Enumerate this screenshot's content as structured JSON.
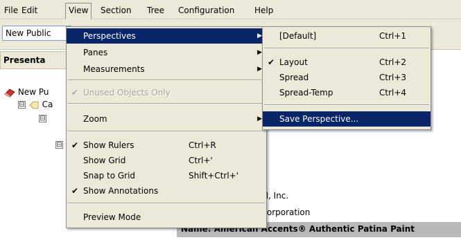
{
  "menubar": {
    "items": [
      "File",
      "Edit",
      "View",
      "Section",
      "Tree",
      "Configuration",
      "Help"
    ]
  },
  "toolbar": {
    "publication_value": "New Public"
  },
  "panel": {
    "header": "Presenta",
    "tree": [
      "New Pu",
      "Ca"
    ],
    "expander_symbol": "⊟",
    "behind_rows": [
      "ational, Inc.",
      "eum Corporation",
      "Name: American Accents® Authentic Patina Paint"
    ]
  },
  "view_menu": {
    "items": [
      {
        "label": "Perspectives",
        "submenu": true,
        "highlighted": true
      },
      {
        "label": "Panes",
        "submenu": true
      },
      {
        "label": "Measurements",
        "submenu": true
      },
      {
        "label": "Unused Objects Only",
        "checked": true,
        "disabled": true
      },
      {
        "label": "Zoom",
        "submenu": true
      },
      {
        "label": "Show Rulers",
        "shortcut": "Ctrl+R",
        "checked": true
      },
      {
        "label": "Show Grid",
        "shortcut": "Ctrl+'"
      },
      {
        "label": "Snap to Grid",
        "shortcut": "Shift+Ctrl+'"
      },
      {
        "label": "Show Annotations",
        "checked": true
      },
      {
        "label": "Preview Mode"
      }
    ]
  },
  "perspectives_menu": {
    "items": [
      {
        "label": "[Default]",
        "shortcut": "Ctrl+1"
      },
      {
        "label": "Layout",
        "shortcut": "Ctrl+2",
        "checked": true
      },
      {
        "label": "Spread",
        "shortcut": "Ctrl+3"
      },
      {
        "label": "Spread-Temp",
        "shortcut": "Ctrl+4"
      },
      {
        "label": "Save Perspective...",
        "highlighted": true
      }
    ]
  },
  "icons": {
    "check": "✔",
    "submenu_arrow": "▶"
  },
  "colors": {
    "menu_bg": "#ece9d8",
    "highlight": "#0a246a"
  }
}
